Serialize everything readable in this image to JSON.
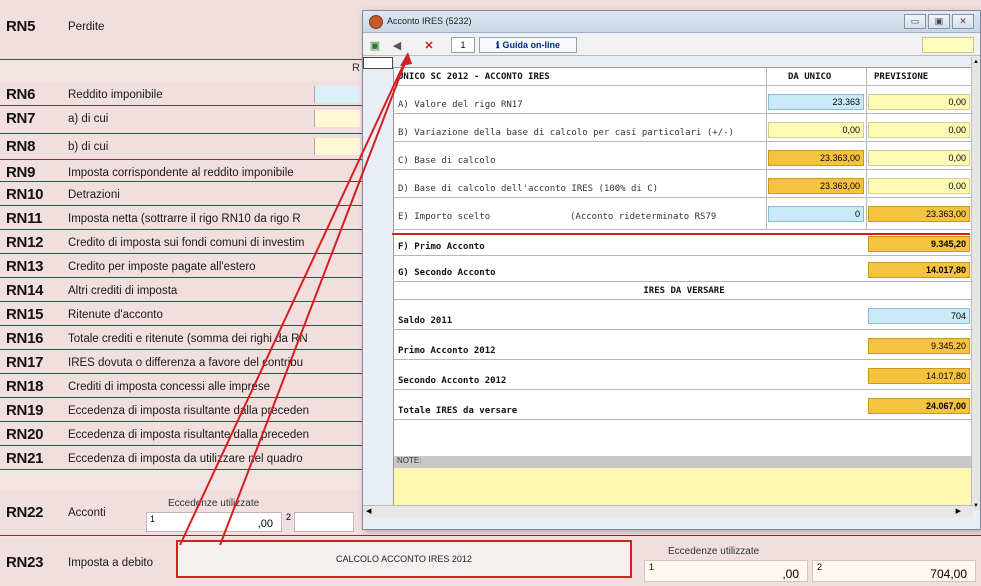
{
  "form": {
    "r_header": "R",
    "rows": [
      {
        "code": "RN5",
        "desc": "Perdite"
      },
      {
        "code": "RN6",
        "desc": "Reddito imponibile"
      },
      {
        "code": "RN7",
        "desc": "a) di cui"
      },
      {
        "code": "RN8",
        "desc": "b) di cui"
      },
      {
        "code": "RN9",
        "desc": "Imposta corrispondente al reddito imponibile"
      },
      {
        "code": "RN10",
        "desc": "Detrazioni"
      },
      {
        "code": "RN11",
        "desc": "Imposta netta (sottrarre il rigo RN10 da rigo R"
      },
      {
        "code": "RN12",
        "desc": "Credito di imposta sui fondi comuni di investim"
      },
      {
        "code": "RN13",
        "desc": "Credito per imposte pagate all'estero"
      },
      {
        "code": "RN14",
        "desc": "Altri crediti di imposta"
      },
      {
        "code": "RN15",
        "desc": "Ritenute d'acconto"
      },
      {
        "code": "RN16",
        "desc": "Totale crediti e ritenute (somma dei righi da RN"
      },
      {
        "code": "RN17",
        "desc": "IRES dovuta o differenza a favore del contribu"
      },
      {
        "code": "RN18",
        "desc": "Crediti di imposta concessi alle imprese"
      },
      {
        "code": "RN19",
        "desc": "Eccedenza di imposta risultante dalla preceden"
      },
      {
        "code": "RN20",
        "desc": "Eccedenza di imposta risultante dalla preceden"
      },
      {
        "code": "RN21",
        "desc": "Eccedenza di imposta da utilizzare nel quadro"
      }
    ],
    "rn22": {
      "code": "RN22",
      "desc": "Acconti",
      "caption": "Eccedenze utilizzate",
      "field1_num": "1",
      "field1_value": ",00",
      "field2_num": "2"
    },
    "rn23": {
      "code": "RN23",
      "desc": "Imposta a debito",
      "caption": "Eccedenze utilizzate",
      "field1_num": "1",
      "field1_value": ",00",
      "field2_num": "2",
      "field2_value": "704,00"
    },
    "calc_button": "CALCOLO ACCONTO IRES 2012"
  },
  "dialog": {
    "title": "Acconto IRES (5232)",
    "controls": {
      "minimize": "▭",
      "maximize": "▣",
      "close": "✕"
    },
    "toolbar": {
      "page": "1",
      "help": "Guida on-line"
    },
    "header": {
      "title": "UNICO SC 2012 - ACCONTO IRES",
      "col1": "DA UNICO",
      "col2": "PREVISIONE"
    },
    "lines": [
      {
        "label": "A) Valore del rigo RN17",
        "v1": "23.363",
        "v2": "0,00"
      },
      {
        "label": "B) Variazione della base di calcolo per casi particolari (+/-)",
        "v1": "0,00",
        "v2": "0,00"
      },
      {
        "label": "C) Base di calcolo",
        "v1": "23.363,00",
        "v2": "0,00"
      },
      {
        "label": "D) Base di calcolo dell'acconto IRES (100% di C)",
        "v1": "23.363,00",
        "v2": "0,00"
      },
      {
        "label": "E) Importo scelto",
        "label2": "(Acconto rideterminato RS79",
        "v1": "0",
        "v2": "23.363,00"
      }
    ],
    "first_acconto": {
      "label": "F) Primo Acconto",
      "value": "9.345,20"
    },
    "second_acconto": {
      "label": "G) Secondo Acconto",
      "value": "14.017,80"
    },
    "versare_header": "IRES DA VERSARE",
    "versare": [
      {
        "label": "Saldo 2011",
        "value": "704"
      },
      {
        "label": "Primo Acconto 2012",
        "value": "9.345,20"
      },
      {
        "label": "Secondo Acconto 2012",
        "value": "14.017,80"
      },
      {
        "label": "Totale IRES da versare",
        "value": "24.067,00"
      }
    ],
    "note_label": "NOTE:"
  }
}
